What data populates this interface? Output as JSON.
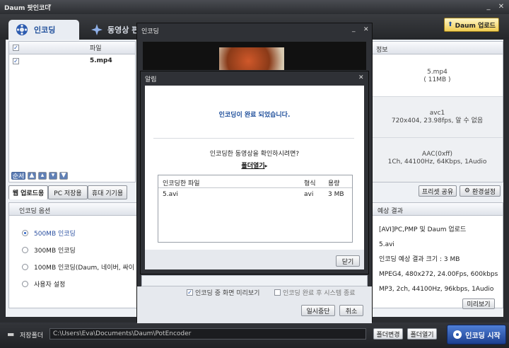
{
  "app": {
    "title": "Daum 팟인코더",
    "title_arrow": "▾",
    "min": "_",
    "close": "✕"
  },
  "tabs": {
    "encoding": "인코딩",
    "video_edit": "동영상 편",
    "daum_upload": "Daum 업로드"
  },
  "file_list": {
    "header_file": "파일",
    "rows": [
      {
        "name": "5.mp4",
        "checked": true
      }
    ],
    "order_label": "순서"
  },
  "info_panel": {
    "header": "정보",
    "file_name": "5.mp4",
    "file_size": "( 11MB )",
    "video_codec": "avc1",
    "video_detail": "720x404, 23.98fps, 알 수 없음",
    "audio_codec": "AAC(0xff)",
    "audio_detail": "1Ch, 44100Hz, 64Kbps, 1Audio"
  },
  "sub_tabs": [
    "웹 업로드용",
    "PC 저장용",
    "휴대 기기용"
  ],
  "right_buttons": {
    "preset_share": "프리셋 공유",
    "settings": "환경설정"
  },
  "options": {
    "header": "인코딩 옵션",
    "items": [
      {
        "label": "500MB 인코딩",
        "selected": true
      },
      {
        "label": "300MB 인코딩",
        "selected": false
      },
      {
        "label": "100MB 인코딩(Daum, 네이버, 싸이",
        "selected": false
      },
      {
        "label": "사용자 설정",
        "selected": false
      }
    ]
  },
  "result": {
    "header": "예상 결과",
    "lines": [
      "[AVI]PC,PMP 및 Daum 업로드",
      "5.avi",
      "인코딩 예상 결과 크기 : 3 MB",
      "MPEG4, 480x272, 24.00Fps, 600kbps",
      "MP3, 2ch, 44100Hz, 96kbps, 1Audio"
    ],
    "preview_button": "미리보기"
  },
  "bottom": {
    "save_folder_label": "저장폴더",
    "save_path": "C:\\Users\\Eva\\Documents\\Daum\\PotEncoder",
    "change_folder": "폴더변경",
    "open_folder": "폴더열기",
    "start": "인코딩 시작"
  },
  "encoding_dialog": {
    "title": "인코딩",
    "preview_during": "인코딩 중 화면 미리보기",
    "shutdown_after": "인코딩 완료 후 시스템 종료",
    "pause": "일시중단",
    "cancel": "취소",
    "min": "_",
    "close": "✕"
  },
  "alert_dialog": {
    "title": "알림",
    "close": "✕",
    "message": "인코딩이 완료 되었습니다.",
    "question": "인코딩한 동영상을 확인하시려면?",
    "open_folder_link": "폴더열기",
    "table_headers": [
      "인코딩한 파일",
      "형식",
      "용량"
    ],
    "table_rows": [
      {
        "file": "5.avi",
        "format": "avi",
        "size": "3 MB"
      }
    ],
    "close_button": "닫기"
  },
  "colors": {
    "accent_blue": "#1f4f9b",
    "link_blue": "#2a4fa0",
    "dark_frame": "#2f3136"
  }
}
